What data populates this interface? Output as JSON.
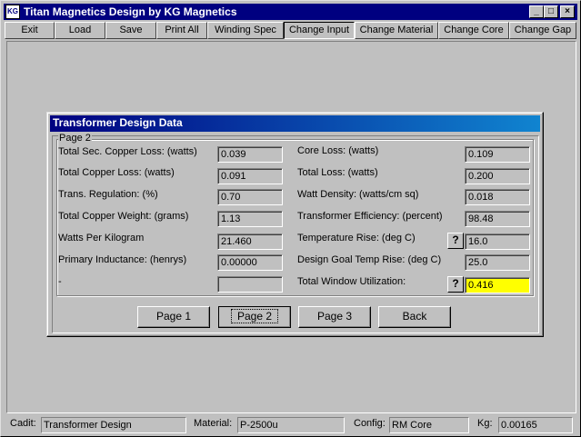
{
  "window": {
    "title": "Titan Magnetics Design by KG Magnetics",
    "icon_text": "KG",
    "minimize_glyph": "_",
    "maximize_glyph": "□",
    "close_glyph": "×"
  },
  "menu": {
    "items": [
      "Exit",
      "Load",
      "Save",
      "Print All",
      "Winding Spec",
      "Change Input",
      "Change Material",
      "Change Core",
      "Change Gap"
    ],
    "pressed": "Change Input"
  },
  "dialog": {
    "title": "Transformer Design Data",
    "group_label": "Page 2",
    "left": [
      {
        "label": "Total Sec. Copper Loss: (watts)",
        "value": "0.039"
      },
      {
        "label": "Total Copper Loss: (watts)",
        "value": "0.091"
      },
      {
        "label": "Trans. Regulation: (%)",
        "value": "0.70"
      },
      {
        "label": "Total Copper Weight: (grams)",
        "value": "1.13"
      },
      {
        "label": "Watts Per Kilogram",
        "value": "21.460"
      },
      {
        "label": "Primary Inductance: (henrys)",
        "value": "0.00000"
      },
      {
        "label": "-",
        "value": ""
      }
    ],
    "right": [
      {
        "label": "Core Loss: (watts)",
        "value": "0.109"
      },
      {
        "label": "Total Loss: (watts)",
        "value": "0.200"
      },
      {
        "label": "Watt Density: (watts/cm sq)",
        "value": "0.018"
      },
      {
        "label": "Transformer Efficiency: (percent)",
        "value": "98.48"
      },
      {
        "label": "Temperature Rise: (deg C)",
        "value": "16.0",
        "help": "?"
      },
      {
        "label": "Design Goal Temp Rise: (deg C)",
        "value": "25.0"
      },
      {
        "label": "Total Window Utilization:",
        "value": "0.416",
        "help": "?",
        "highlight_color": "#ffff00"
      }
    ],
    "buttons": [
      "Page 1",
      "Page 2",
      "Page 3",
      "Back"
    ],
    "focused_button": "Page 2"
  },
  "status": {
    "cadit_label": "Cadit:",
    "cadit_value": "Transformer Design",
    "material_label": "Material:",
    "material_value": "P-2500u",
    "config_label": "Config:",
    "config_value": "RM Core",
    "kg_label": "Kg:",
    "kg_value": "0.00165"
  }
}
